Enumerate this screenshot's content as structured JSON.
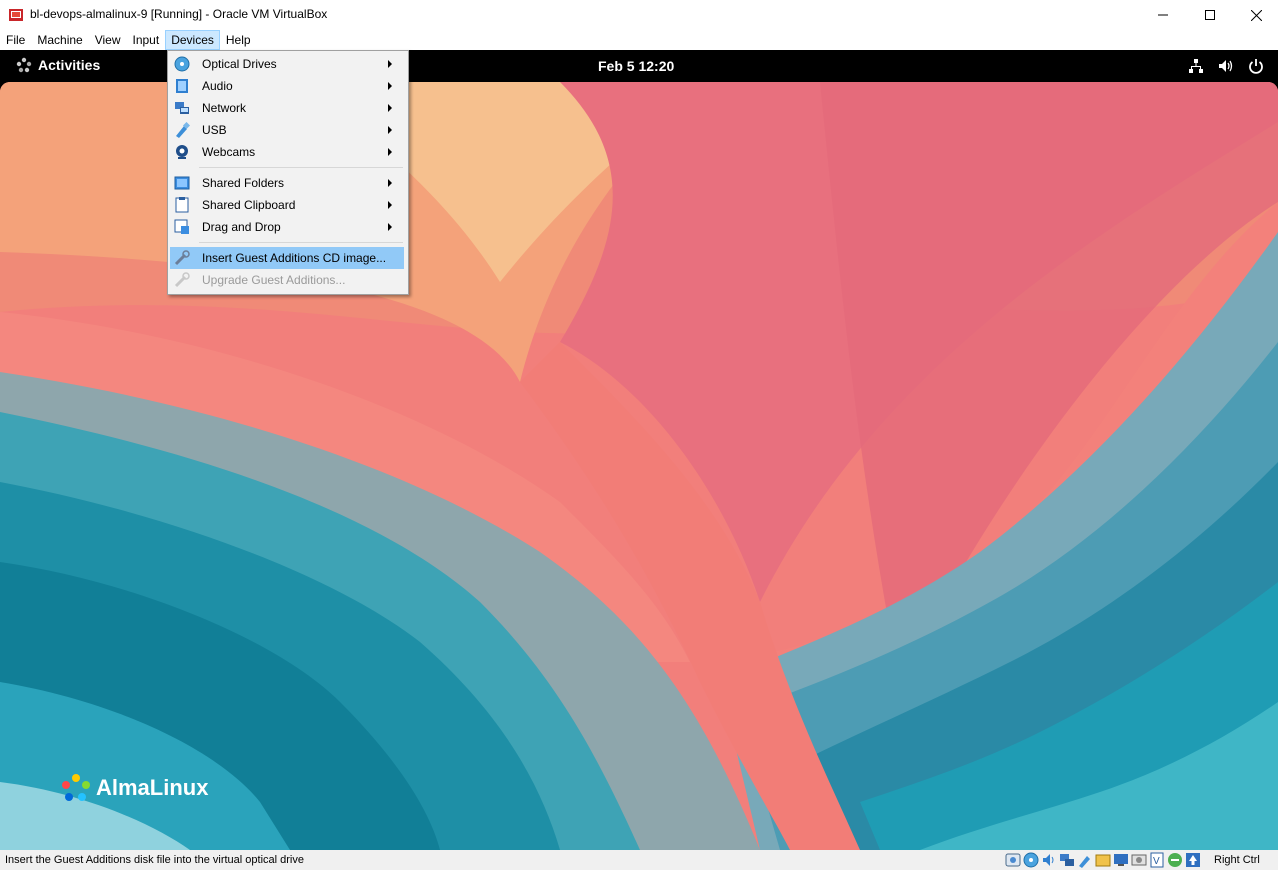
{
  "window": {
    "title": "bl-devops-almalinux-9 [Running] - Oracle VM VirtualBox",
    "icon": "virtualbox-icon",
    "controls": [
      "minimize-icon",
      "maximize-icon",
      "close-icon"
    ]
  },
  "menubar": {
    "items": [
      {
        "label": "File"
      },
      {
        "label": "Machine"
      },
      {
        "label": "View"
      },
      {
        "label": "Input"
      },
      {
        "label": "Devices",
        "active": true
      },
      {
        "label": "Help"
      }
    ]
  },
  "devices_menu": {
    "items": [
      {
        "label": "Optical Drives",
        "icon": "optical-disc-icon",
        "submenu": true
      },
      {
        "label": "Audio",
        "icon": "audio-icon",
        "submenu": true
      },
      {
        "label": "Network",
        "icon": "network-icon",
        "submenu": true
      },
      {
        "label": "USB",
        "icon": "usb-icon",
        "submenu": true
      },
      {
        "label": "Webcams",
        "icon": "webcam-icon",
        "submenu": true
      },
      {
        "label": "Shared Folders",
        "icon": "shared-folder-icon",
        "submenu": true
      },
      {
        "label": "Shared Clipboard",
        "icon": "clipboard-icon",
        "submenu": true
      },
      {
        "label": "Drag and Drop",
        "icon": "drag-drop-icon",
        "submenu": true
      },
      {
        "label": "Insert Guest Additions CD image...",
        "icon": "guest-additions-icon",
        "highlighted": true
      },
      {
        "label": "Upgrade Guest Additions...",
        "icon": "upgrade-icon",
        "disabled": true
      }
    ]
  },
  "guest": {
    "activities_label": "Activities",
    "clock": "Feb 5  12:20",
    "tray_icons": [
      "network-wired-icon",
      "volume-icon",
      "power-icon"
    ],
    "brand": "AlmaLinux"
  },
  "statusbar": {
    "message": "Insert the Guest Additions disk file into the virtual optical drive",
    "host_key": "Right Ctrl",
    "icons": [
      "hard-disk-icon",
      "optical-drive-icon",
      "audio-icon",
      "network-icon",
      "usb-icon",
      "shared-folders-icon",
      "display-icon",
      "video-capture-icon",
      "virtualization-icon",
      "mouse-integration-icon",
      "host-key-arrow-icon"
    ]
  },
  "colors": {
    "menu_highlight": "#91c9f7",
    "menubar_active": "#cce8ff",
    "gnome_bar": "#000000",
    "wall_coral": "#f07a78",
    "wall_teal": "#1e8fa6"
  }
}
